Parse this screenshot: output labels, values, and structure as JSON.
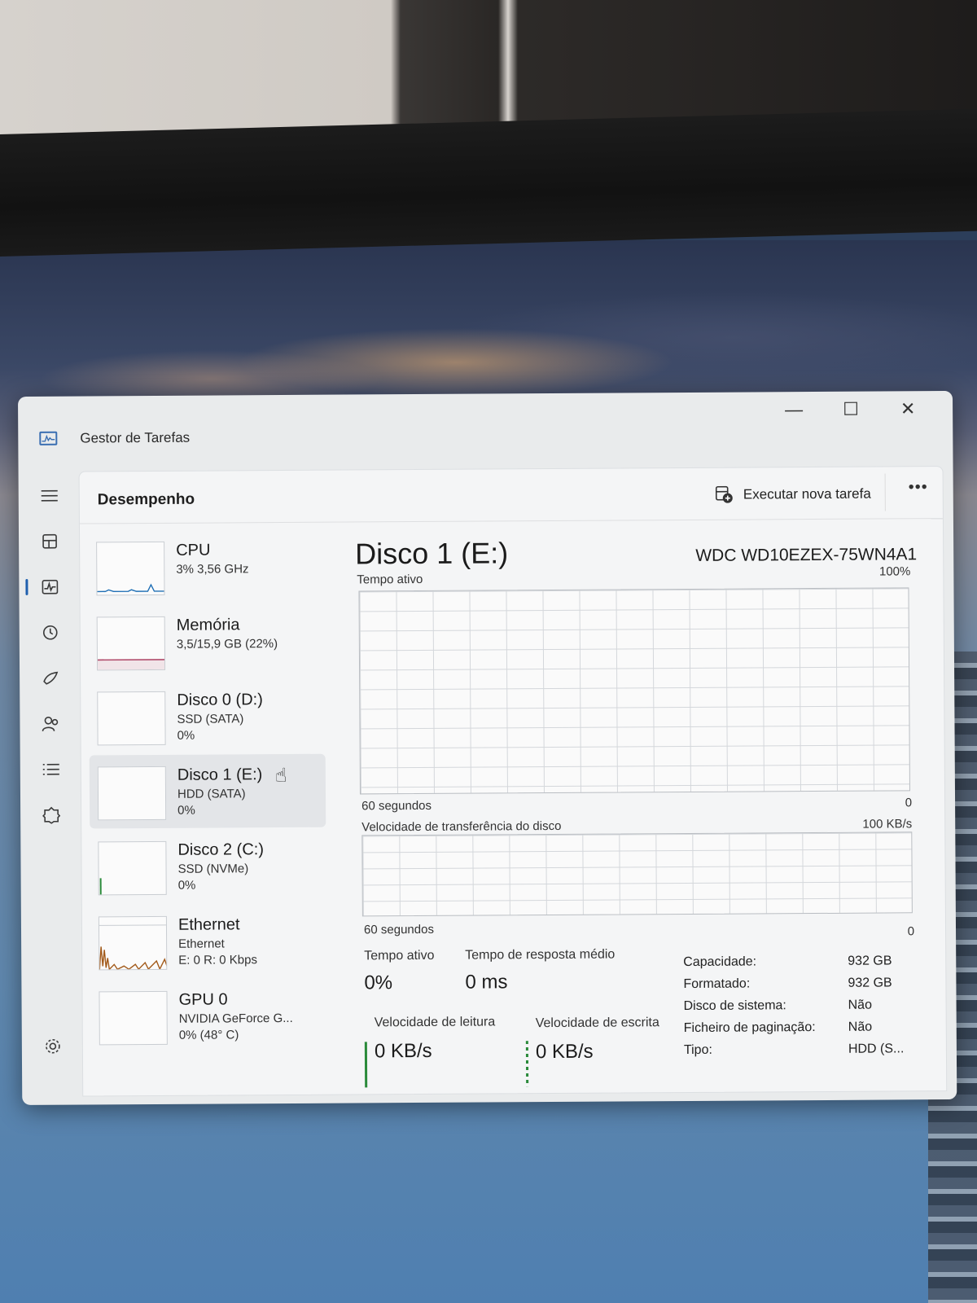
{
  "window": {
    "title": "Gestor de Tarefas",
    "controls": {
      "minimize": "—",
      "maximize": "☐",
      "close": "✕"
    }
  },
  "header": {
    "page_title": "Desempenho",
    "run_task_label": "Executar nova tarefa",
    "more_label": "•••"
  },
  "rail": {
    "items": [
      "menu-icon",
      "processes-icon",
      "performance-icon",
      "history-icon",
      "startup-icon",
      "users-icon",
      "details-icon",
      "services-icon"
    ],
    "active": "performance-icon",
    "footer": "settings-icon"
  },
  "devices": [
    {
      "name": "CPU",
      "sub1": "3% 3,56 GHz",
      "sub2": ""
    },
    {
      "name": "Memória",
      "sub1": "3,5/15,9 GB (22%)",
      "sub2": ""
    },
    {
      "name": "Disco 0 (D:)",
      "sub1": "SSD (SATA)",
      "sub2": "0%"
    },
    {
      "name": "Disco 1 (E:)",
      "sub1": "HDD (SATA)",
      "sub2": "0%"
    },
    {
      "name": "Disco 2 (C:)",
      "sub1": "SSD (NVMe)",
      "sub2": "0%"
    },
    {
      "name": "Ethernet",
      "sub1": "Ethernet",
      "sub2": "E: 0 R: 0 Kbps"
    },
    {
      "name": "GPU 0",
      "sub1": "NVIDIA GeForce G...",
      "sub2": "0% (48° C)"
    }
  ],
  "selected_device": "Disco 1 (E:)",
  "detail": {
    "title": "Disco 1 (E:)",
    "model": "WDC WD10EZEX-75WN4A1",
    "graph1": {
      "label": "Tempo ativo",
      "max": "100%",
      "time": "60 segundos",
      "min": "0"
    },
    "graph2": {
      "label": "Velocidade de transferência do disco",
      "max": "100 KB/s",
      "time": "60 segundos",
      "min": "0"
    },
    "stats": {
      "active_time_label": "Tempo ativo",
      "active_time_value": "0%",
      "response_label": "Tempo de resposta médio",
      "response_value": "0 ms",
      "read_label": "Velocidade de leitura",
      "read_value": "0 KB/s",
      "write_label": "Velocidade de escrita",
      "write_value": "0 KB/s"
    },
    "properties": [
      {
        "key": "Capacidade:",
        "value": "932 GB"
      },
      {
        "key": "Formatado:",
        "value": "932 GB"
      },
      {
        "key": "Disco de sistema:",
        "value": "Não"
      },
      {
        "key": "Ficheiro de paginação:",
        "value": "Não"
      },
      {
        "key": "Tipo:",
        "value": "HDD (S..."
      }
    ]
  },
  "colors": {
    "accent": "#1f5fae",
    "graph_grid": "#d4d7db",
    "memory_line": "#b04a6a",
    "disk_line": "#2a8a3a",
    "ethernet_line": "#a25a1a",
    "cpu_line": "#1f6fb5"
  }
}
